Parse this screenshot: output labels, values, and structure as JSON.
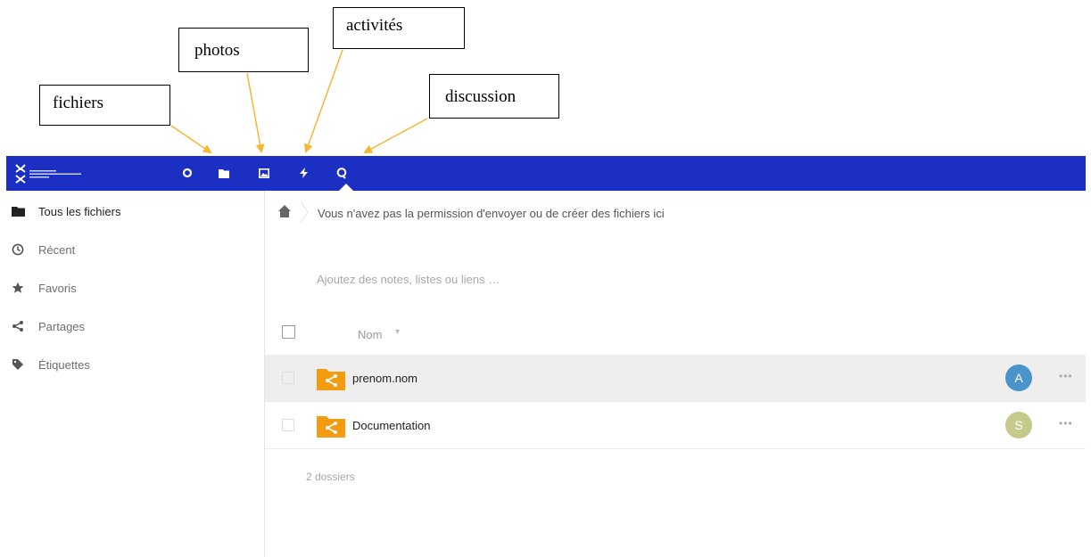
{
  "callouts": {
    "fichiers": "fichiers",
    "photos": "photos",
    "activites": "activités",
    "discussion": "discussion"
  },
  "colors": {
    "header_bg": "#1b2fc3",
    "arrow": "#f5b731",
    "folder": "#f39c12",
    "avatar_a": "#4a94c9",
    "avatar_s": "#c5c98b"
  },
  "header": {
    "apps": [
      {
        "name": "dashboard-icon"
      },
      {
        "name": "files-icon"
      },
      {
        "name": "photos-icon"
      },
      {
        "name": "activity-icon"
      },
      {
        "name": "talk-icon"
      }
    ],
    "active_app": "talk"
  },
  "sidebar": {
    "items": [
      {
        "label": "Tous les fichiers",
        "icon": "folder-icon"
      },
      {
        "label": "Récent",
        "icon": "clock-icon"
      },
      {
        "label": "Favoris",
        "icon": "star-icon"
      },
      {
        "label": "Partages",
        "icon": "share-icon"
      },
      {
        "label": "Étiquettes",
        "icon": "tag-icon"
      }
    ]
  },
  "main": {
    "permission_message": "Vous n'avez pas la permission d'envoyer ou de créer des fichiers ici",
    "notes_placeholder": "Ajoutez des notes, listes ou liens …",
    "column_name": "Nom",
    "files": [
      {
        "name": "prenom.nom",
        "avatar": "A"
      },
      {
        "name": "Documentation",
        "avatar": "S"
      }
    ],
    "summary": "2 dossiers"
  }
}
